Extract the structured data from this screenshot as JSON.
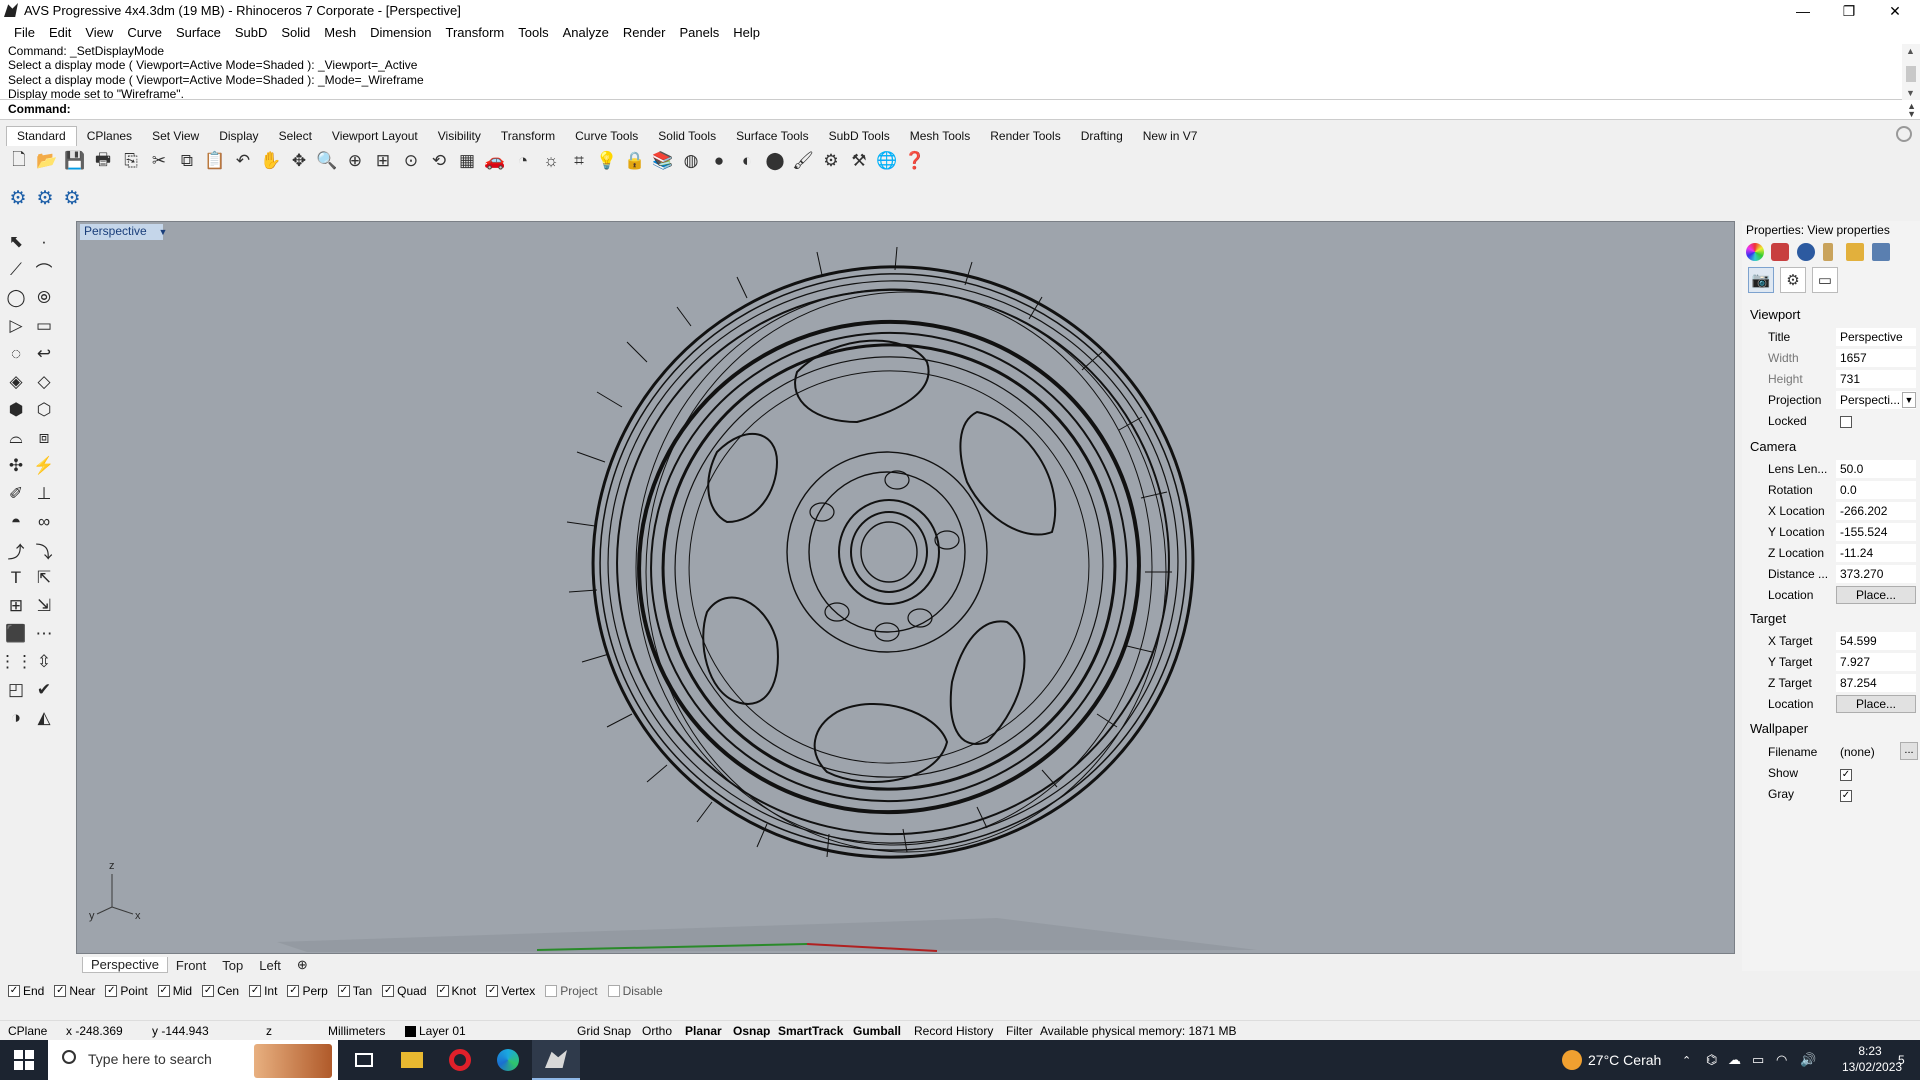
{
  "window": {
    "title": "AVS Progressive 4x4.3dm (19 MB) - Rhinoceros 7 Corporate - [Perspective]",
    "minimize": "—",
    "maximize": "❐",
    "close": "✕"
  },
  "menu": [
    "File",
    "Edit",
    "View",
    "Curve",
    "Surface",
    "SubD",
    "Solid",
    "Mesh",
    "Dimension",
    "Transform",
    "Tools",
    "Analyze",
    "Render",
    "Panels",
    "Help"
  ],
  "command_history": [
    "Command: _SetDisplayMode",
    "Select a display mode ( Viewport=Active  Mode=Shaded ): _Viewport=_Active",
    "Select a display mode ( Viewport=Active  Mode=Shaded ): _Mode=_Wireframe",
    "Display mode set to \"Wireframe\"."
  ],
  "command_prompt": {
    "label": "Command:",
    "value": ""
  },
  "toolbar_tabs": [
    "Standard",
    "CPlanes",
    "Set View",
    "Display",
    "Select",
    "Viewport Layout",
    "Visibility",
    "Transform",
    "Curve Tools",
    "Solid Tools",
    "Surface Tools",
    "SubD Tools",
    "Mesh Tools",
    "Render Tools",
    "Drafting",
    "New in V7"
  ],
  "toolbar_icons": [
    "new-file-icon",
    "open-icon",
    "save-icon",
    "print-icon",
    "import-icon",
    "cut-icon",
    "copy-icon",
    "paste-icon",
    "undo-icon",
    "pan-hand-icon",
    "move-view-icon",
    "zoom-icon",
    "zoom-window-icon",
    "zoom-extents-icon",
    "zoom-selected-icon",
    "rotate-view-icon",
    "four-viewports-icon",
    "car-icon",
    "spotlight-icon",
    "sun-icon",
    "grid-icon",
    "lightbulb-icon",
    "lock-icon",
    "layers-icon",
    "color-wheel-icon",
    "shaded-sphere-icon",
    "rendered-sphere-icon",
    "blue-sphere-icon",
    "brush-icon",
    "settings-gears-icon",
    "options-icon",
    "globe-icon",
    "help-icon"
  ],
  "toolbar_glyphs": [
    "🗋",
    "📂",
    "💾",
    "🖶",
    "⎘",
    "✂",
    "⧉",
    "📋",
    "↶",
    "✋",
    "✥",
    "🔍",
    "⊕",
    "⊞",
    "⊙",
    "⟲",
    "▦",
    "🚗",
    "◔",
    "☼",
    "⌗",
    "💡",
    "🔒",
    "📚",
    "◍",
    "●",
    "◐",
    "⬤",
    "🖌",
    "⚙",
    "⚒",
    "🌐",
    "❓"
  ],
  "toolbar2_icons": [
    "gear-blue-icon-1",
    "gear-blue-icon-2",
    "gear-blue-icon-3"
  ],
  "left_tools": [
    [
      "select-arrow-icon",
      "point-icon"
    ],
    [
      "polyline-icon",
      "curve-icon"
    ],
    [
      "circle-icon",
      "ellipse-icon"
    ],
    [
      "polygon-icon",
      "rectangle-icon"
    ],
    [
      "arc-icon",
      "fillet-icon"
    ],
    [
      "surface-icon",
      "surface-edit-icon"
    ],
    [
      "box-icon",
      "solid-union-icon"
    ],
    [
      "extrude-icon",
      "loft-icon"
    ],
    [
      "mesh-icon",
      "transform-icon"
    ],
    [
      "move-icon",
      "align-icon"
    ],
    [
      "boolean-icon",
      "split-icon"
    ],
    [
      "trim-icon",
      "join-icon"
    ],
    [
      "text-icon",
      "scale-icon"
    ],
    [
      "array-icon",
      "mirror-icon"
    ],
    [
      "block-icon",
      "dimension-icon"
    ],
    [
      "grid-array-icon",
      "gumball-icon"
    ],
    [
      "analyze-icon",
      "check-icon"
    ],
    [
      "render-icon",
      "light-icon"
    ]
  ],
  "left_glyphs": [
    [
      "⬉",
      "·"
    ],
    [
      "⟋",
      "⌒"
    ],
    [
      "◯",
      "⦾"
    ],
    [
      "▷",
      "▭"
    ],
    [
      "◌",
      "↩"
    ],
    [
      "◈",
      "◇"
    ],
    [
      "⬢",
      "⬡"
    ],
    [
      "⌓",
      "⧈"
    ],
    [
      "✣",
      "⚡"
    ],
    [
      "✐",
      "⊥"
    ],
    [
      "◓",
      "∞"
    ],
    [
      "⤴",
      "⤵"
    ],
    [
      "T",
      "⇱"
    ],
    [
      "⊞",
      "⇲"
    ],
    [
      "⬛",
      "⋯"
    ],
    [
      "⋮⋮",
      "⇳"
    ],
    [
      "◰",
      "✔"
    ],
    [
      "◑",
      "◭"
    ]
  ],
  "viewport": {
    "title": "Perspective",
    "axes": {
      "x": "x",
      "y": "y",
      "z": "z"
    }
  },
  "viewport_tabs": [
    "Perspective",
    "Front",
    "Top",
    "Left"
  ],
  "osnaps": [
    {
      "label": "End",
      "checked": true
    },
    {
      "label": "Near",
      "checked": true
    },
    {
      "label": "Point",
      "checked": true
    },
    {
      "label": "Mid",
      "checked": true
    },
    {
      "label": "Cen",
      "checked": true
    },
    {
      "label": "Int",
      "checked": true
    },
    {
      "label": "Perp",
      "checked": true
    },
    {
      "label": "Tan",
      "checked": true
    },
    {
      "label": "Quad",
      "checked": true
    },
    {
      "label": "Knot",
      "checked": true
    },
    {
      "label": "Vertex",
      "checked": true
    },
    {
      "label": "Project",
      "checked": false
    },
    {
      "label": "Disable",
      "checked": false
    }
  ],
  "status": {
    "cplane": "CPlane",
    "x": "x -248.369",
    "y": "y -144.943",
    "z": "z",
    "units": "Millimeters",
    "layer": "Layer 01",
    "grid_snap": "Grid Snap",
    "ortho": "Ortho",
    "planar": "Planar",
    "osnap": "Osnap",
    "smarttrack": "SmartTrack",
    "gumball": "Gumball",
    "record_history": "Record History",
    "filter": "Filter",
    "memory": "Available physical memory: 1871 MB"
  },
  "properties": {
    "header": "Properties: View properties",
    "viewport_section": "Viewport",
    "title_label": "Title",
    "title_value": "Perspective",
    "width_label": "Width",
    "width_value": "1657",
    "height_label": "Height",
    "height_value": "731",
    "projection_label": "Projection",
    "projection_value": "Perspecti...",
    "locked_label": "Locked",
    "camera_section": "Camera",
    "lens_label": "Lens Len...",
    "lens_value": "50.0",
    "rotation_label": "Rotation",
    "rotation_value": "0.0",
    "xloc_label": "X Location",
    "xloc_value": "-266.202",
    "yloc_label": "Y Location",
    "yloc_value": "-155.524",
    "zloc_label": "Z Location",
    "zloc_value": "-11.24",
    "distance_label": "Distance ...",
    "distance_value": "373.270",
    "location_label": "Location",
    "place_button": "Place...",
    "target_section": "Target",
    "xtarget_label": "X Target",
    "xtarget_value": "54.599",
    "ytarget_label": "Y Target",
    "ytarget_value": "7.927",
    "ztarget_label": "Z Target",
    "ztarget_value": "87.254",
    "target_location_label": "Location",
    "target_place_button": "Place...",
    "wallpaper_section": "Wallpaper",
    "filename_label": "Filename",
    "filename_value": "(none)",
    "filename_button": "...",
    "show_label": "Show",
    "show_checked": true,
    "gray_label": "Gray",
    "gray_checked": true
  },
  "taskbar": {
    "search_placeholder": "Type here to search",
    "weather": "27°C  Cerah",
    "time": "8:23",
    "date": "13/02/2023",
    "notifications": "5"
  }
}
